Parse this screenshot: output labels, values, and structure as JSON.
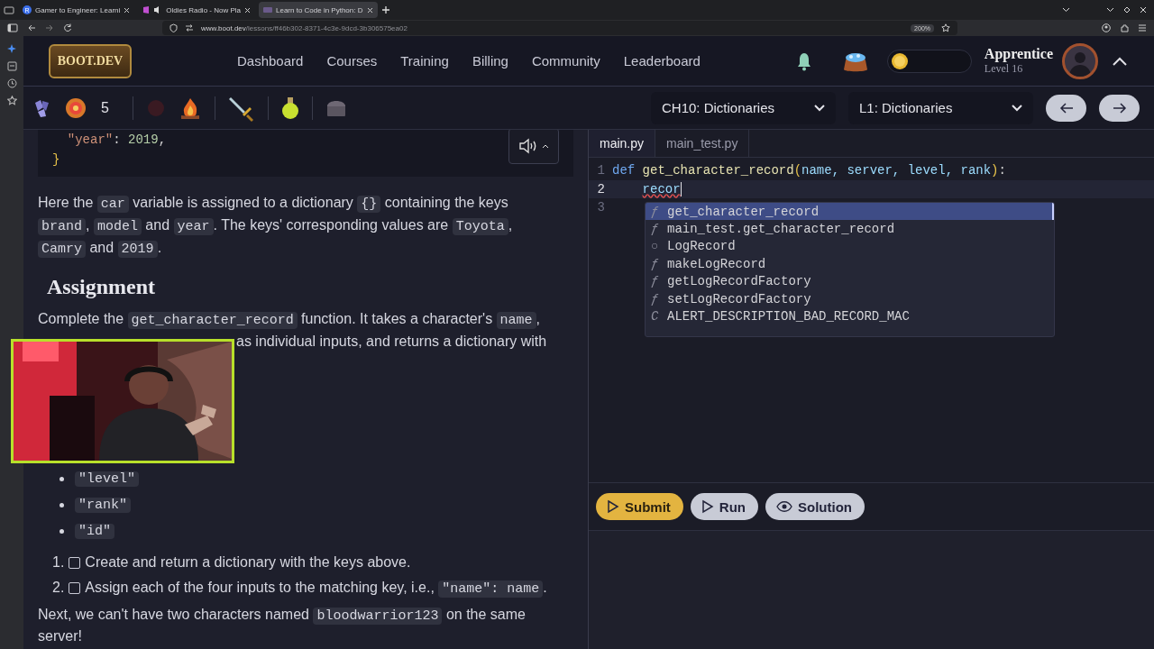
{
  "browser": {
    "tabs": [
      {
        "title": "Gamer to Engineer: Learni",
        "selected": false,
        "kind": "letter",
        "badge": "R"
      },
      {
        "title": "Oldies Radio - Now Pla",
        "selected": false,
        "kind": "audio"
      },
      {
        "title": "Learn to Code in Python: D",
        "selected": true,
        "kind": "site"
      }
    ],
    "url": {
      "host": "www.boot.dev",
      "path": "/lessons/ff46b302-8371-4c3e-9dcd-3b306575ea02"
    },
    "zoom": "200%"
  },
  "header": {
    "logo": "BOOT.DEV",
    "nav": [
      "Dashboard",
      "Courses",
      "Training",
      "Billing",
      "Community",
      "Leaderboard"
    ],
    "rank": "Apprentice",
    "level": "Level 16"
  },
  "toolbar": {
    "count": "5",
    "chapter": "CH10: Dictionaries",
    "lesson": "L1: Dictionaries"
  },
  "lesson": {
    "code": [
      [
        {
          "t": "\"year\"",
          "kind": "string",
          "indented": true
        },
        {
          "t": ": ",
          "kind": "plain"
        },
        {
          "t": "2019",
          "kind": "number"
        },
        {
          "t": ",",
          "kind": "plain"
        }
      ],
      [
        {
          "t": "}",
          "kind": "brace"
        }
      ]
    ],
    "intro": [
      [
        {
          "t": "Here the ",
          "kind": "text"
        },
        {
          "t": "car",
          "kind": "code"
        },
        {
          "t": " variable is assigned to a dictionary ",
          "kind": "text"
        },
        {
          "t": "{}",
          "kind": "code"
        },
        {
          "t": " containing the keys",
          "kind": "text"
        }
      ],
      [
        {
          "t": "brand",
          "kind": "code"
        },
        {
          "t": ", ",
          "kind": "text"
        },
        {
          "t": "model",
          "kind": "code"
        },
        {
          "t": " and ",
          "kind": "text"
        },
        {
          "t": "year",
          "kind": "code"
        },
        {
          "t": ". The keys' corresponding values are ",
          "kind": "text"
        },
        {
          "t": "Toyota",
          "kind": "code"
        },
        {
          "t": ",",
          "kind": "text"
        }
      ],
      [
        {
          "t": "Camry",
          "kind": "code"
        },
        {
          "t": " and ",
          "kind": "text"
        },
        {
          "t": "2019",
          "kind": "code"
        },
        {
          "t": ".",
          "kind": "text"
        }
      ]
    ],
    "heading": "Assignment",
    "task_line": [
      {
        "t": "Complete the ",
        "kind": "text"
      },
      {
        "t": "get_character_record",
        "kind": "code"
      },
      {
        "t": " function. It takes a character's ",
        "kind": "text"
      },
      {
        "t": "name",
        "kind": "code"
      },
      {
        "t": ",",
        "kind": "text"
      }
    ],
    "task_line_2": "as individual inputs, and returns a dictionary with",
    "keys": [
      "\"level\"",
      "\"rank\"",
      "\"id\""
    ],
    "steps": [
      {
        "number": "1.",
        "checked": false,
        "parts": [
          {
            "t": "Create and return a dictionary with the keys above.",
            "kind": "text"
          }
        ]
      },
      {
        "number": "2.",
        "checked": false,
        "parts": [
          {
            "t": "Assign each of the four inputs to the matching key, i.e., ",
            "kind": "text"
          },
          {
            "t": "\"name\": name",
            "kind": "code"
          },
          {
            "t": ".",
            "kind": "text"
          }
        ]
      }
    ],
    "outro": [
      [
        {
          "t": "Next, we can't have two characters named ",
          "kind": "text"
        },
        {
          "t": "bloodwarrior123",
          "kind": "code"
        },
        {
          "t": " on the same",
          "kind": "text"
        }
      ],
      [
        {
          "t": "server!",
          "kind": "text"
        }
      ]
    ]
  },
  "editor": {
    "tabs": [
      {
        "label": "main.py",
        "selected": true
      },
      {
        "label": "main_test.py",
        "selected": false
      }
    ],
    "lines": [
      {
        "number": "1",
        "active": false,
        "cursor": false,
        "tokens": [
          {
            "t": "def",
            "kind": "keyword"
          },
          {
            "t": "get_character_record",
            "kind": "function"
          },
          {
            "t": "(",
            "kind": "paren"
          },
          {
            "t": "name, server, level, rank",
            "kind": "param"
          },
          {
            "t": ")",
            "kind": "paren"
          },
          {
            "t": ":",
            "kind": "plain"
          }
        ]
      },
      {
        "number": "2",
        "active": true,
        "cursor": true,
        "tokens": [
          {
            "t": "recor",
            "kind": "error",
            "indented": true
          }
        ]
      },
      {
        "number": "3",
        "active": false,
        "cursor": false
      }
    ],
    "suggestions": [
      {
        "icon": "ƒ",
        "label": "get_character_record",
        "selected": true
      },
      {
        "icon": "ƒ",
        "label": "main_test.get_character_record",
        "selected": false
      },
      {
        "icon": "○",
        "label": "LogRecord",
        "selected": false
      },
      {
        "icon": "ƒ",
        "label": "makeLogRecord",
        "selected": false
      },
      {
        "icon": "ƒ",
        "label": "getLogRecordFactory",
        "selected": false
      },
      {
        "icon": "ƒ",
        "label": "setLogRecordFactory",
        "selected": false
      },
      {
        "icon": "C",
        "label": "ALERT_DESCRIPTION_BAD_RECORD_MAC",
        "selected": false
      }
    ],
    "buttons": [
      {
        "label": "Submit",
        "kind": "primary"
      },
      {
        "label": "Run",
        "kind": "run"
      },
      {
        "label": "Solution",
        "kind": "solution"
      }
    ]
  }
}
